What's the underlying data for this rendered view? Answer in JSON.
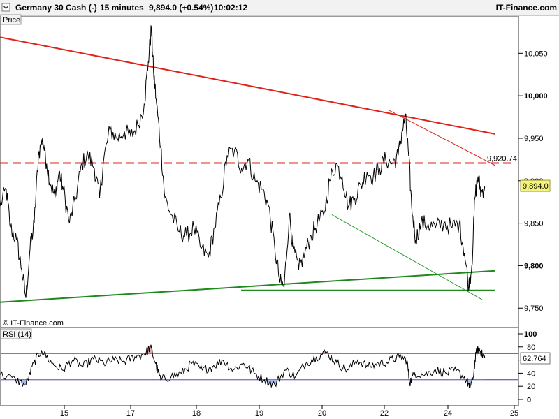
{
  "header": {
    "symbol": "Germany 30 Cash (-)",
    "interval": "15 minutes",
    "last": "9,894.0 (+0.54%)",
    "time": "10:02:12",
    "brand": "IT-Finance.com"
  },
  "copyright": "© IT-Finance.com",
  "chart_data": [
    {
      "type": "line",
      "title": "Price",
      "y_range": [
        9728,
        10093
      ],
      "y_ticks": [
        {
          "value": 9750,
          "label": "9,750"
        },
        {
          "value": 9800,
          "label": "9,800"
        },
        {
          "value": 9850,
          "label": "9,850"
        },
        {
          "value": 9900,
          "label": "9,900"
        },
        {
          "value": 9950,
          "label": "9,950"
        },
        {
          "value": 10000,
          "label": "10,000"
        },
        {
          "value": 10050,
          "label": "10,050"
        }
      ],
      "x_ticks": [
        "15",
        "17",
        "18",
        "19",
        "20",
        "22",
        "24",
        "25"
      ],
      "price_anchors": [
        [
          0,
          9870
        ],
        [
          0.012,
          9890
        ],
        [
          0.02,
          9845
        ],
        [
          0.032,
          9830
        ],
        [
          0.042,
          9795
        ],
        [
          0.05,
          9762
        ],
        [
          0.058,
          9820
        ],
        [
          0.066,
          9850
        ],
        [
          0.074,
          9930
        ],
        [
          0.082,
          9950
        ],
        [
          0.09,
          9920
        ],
        [
          0.098,
          9895
        ],
        [
          0.106,
          9880
        ],
        [
          0.114,
          9910
        ],
        [
          0.122,
          9890
        ],
        [
          0.134,
          9850
        ],
        [
          0.146,
          9880
        ],
        [
          0.158,
          9920
        ],
        [
          0.17,
          9930
        ],
        [
          0.182,
          9915
        ],
        [
          0.192,
          9880
        ],
        [
          0.2,
          9925
        ],
        [
          0.212,
          9960
        ],
        [
          0.226,
          9950
        ],
        [
          0.24,
          9958
        ],
        [
          0.252,
          9952
        ],
        [
          0.266,
          9965
        ],
        [
          0.278,
          9990
        ],
        [
          0.286,
          10040
        ],
        [
          0.292,
          10080
        ],
        [
          0.296,
          10030
        ],
        [
          0.302,
          9990
        ],
        [
          0.31,
          9940
        ],
        [
          0.318,
          9880
        ],
        [
          0.33,
          9860
        ],
        [
          0.346,
          9840
        ],
        [
          0.36,
          9835
        ],
        [
          0.374,
          9845
        ],
        [
          0.388,
          9820
        ],
        [
          0.402,
          9810
        ],
        [
          0.414,
          9845
        ],
        [
          0.426,
          9880
        ],
        [
          0.438,
          9930
        ],
        [
          0.452,
          9935
        ],
        [
          0.466,
          9915
        ],
        [
          0.478,
          9925
        ],
        [
          0.492,
          9900
        ],
        [
          0.506,
          9890
        ],
        [
          0.518,
          9870
        ],
        [
          0.53,
          9820
        ],
        [
          0.54,
          9780
        ],
        [
          0.548,
          9775
        ],
        [
          0.558,
          9860
        ],
        [
          0.566,
          9820
        ],
        [
          0.576,
          9795
        ],
        [
          0.588,
          9815
        ],
        [
          0.6,
          9835
        ],
        [
          0.612,
          9850
        ],
        [
          0.624,
          9860
        ],
        [
          0.636,
          9900
        ],
        [
          0.648,
          9920
        ],
        [
          0.66,
          9905
        ],
        [
          0.672,
          9870
        ],
        [
          0.684,
          9880
        ],
        [
          0.696,
          9895
        ],
        [
          0.708,
          9910
        ],
        [
          0.72,
          9905
        ],
        [
          0.732,
          9915
        ],
        [
          0.744,
          9925
        ],
        [
          0.756,
          9920
        ],
        [
          0.768,
          9930
        ],
        [
          0.776,
          9960
        ],
        [
          0.782,
          9975
        ],
        [
          0.788,
          9930
        ],
        [
          0.794,
          9870
        ],
        [
          0.802,
          9830
        ],
        [
          0.812,
          9850
        ],
        [
          0.826,
          9848
        ],
        [
          0.84,
          9845
        ],
        [
          0.856,
          9850
        ],
        [
          0.872,
          9845
        ],
        [
          0.886,
          9850
        ],
        [
          0.896,
          9815
        ],
        [
          0.904,
          9775
        ],
        [
          0.91,
          9800
        ],
        [
          0.916,
          9880
        ],
        [
          0.922,
          9905
        ],
        [
          0.928,
          9885
        ],
        [
          0.935,
          9894
        ]
      ],
      "lines": [
        {
          "name": "descending-resistance",
          "color": "#e0231a",
          "width": 2,
          "points": [
            [
              0,
              10069
            ],
            [
              0.955,
              9955
            ]
          ]
        },
        {
          "name": "short-resistance",
          "color": "#e0231a",
          "width": 1,
          "points": [
            [
              0.75,
              9983
            ],
            [
              0.955,
              9918
            ]
          ]
        },
        {
          "name": "horizontal-level",
          "color": "#e0231a",
          "width": 2,
          "dash": true,
          "label": "9,920.74",
          "points": [
            [
              0,
              9920.74
            ],
            [
              0.995,
              9920.74
            ]
          ]
        },
        {
          "name": "rising-support",
          "color": "#1e8a1e",
          "width": 2,
          "points": [
            [
              0,
              9757
            ],
            [
              0.955,
              9794
            ]
          ]
        },
        {
          "name": "horizontal-support",
          "color": "#1e8a1e",
          "width": 2,
          "points": [
            [
              0.465,
              9771
            ],
            [
              0.955,
              9771
            ]
          ]
        },
        {
          "name": "falling-support",
          "color": "#2e9a2e",
          "width": 1,
          "points": [
            [
              0.64,
              9860
            ],
            [
              0.93,
              9760
            ]
          ]
        }
      ],
      "last_value_label": "9,894.0"
    },
    {
      "type": "line",
      "title": "RSI (14)",
      "y_range": [
        0,
        100
      ],
      "y_ticks": [
        {
          "value": 0,
          "label": "0"
        },
        {
          "value": 20,
          "label": "20"
        },
        {
          "value": 40,
          "label": "40"
        },
        {
          "value": 60,
          "label": "60"
        },
        {
          "value": 80,
          "label": "80"
        },
        {
          "value": 100,
          "label": "100"
        }
      ],
      "levels": [
        70,
        30
      ],
      "rsi_anchors": [
        [
          0,
          38
        ],
        [
          0.03,
          30
        ],
        [
          0.05,
          22
        ],
        [
          0.065,
          55
        ],
        [
          0.08,
          75
        ],
        [
          0.1,
          55
        ],
        [
          0.12,
          45
        ],
        [
          0.14,
          60
        ],
        [
          0.16,
          50
        ],
        [
          0.18,
          62
        ],
        [
          0.2,
          55
        ],
        [
          0.22,
          60
        ],
        [
          0.24,
          58
        ],
        [
          0.26,
          65
        ],
        [
          0.28,
          70
        ],
        [
          0.29,
          80
        ],
        [
          0.3,
          55
        ],
        [
          0.31,
          30
        ],
        [
          0.33,
          35
        ],
        [
          0.35,
          40
        ],
        [
          0.37,
          55
        ],
        [
          0.39,
          45
        ],
        [
          0.41,
          50
        ],
        [
          0.43,
          60
        ],
        [
          0.45,
          45
        ],
        [
          0.47,
          55
        ],
        [
          0.49,
          40
        ],
        [
          0.51,
          30
        ],
        [
          0.53,
          22
        ],
        [
          0.55,
          45
        ],
        [
          0.57,
          35
        ],
        [
          0.59,
          55
        ],
        [
          0.61,
          65
        ],
        [
          0.63,
          72
        ],
        [
          0.65,
          55
        ],
        [
          0.67,
          45
        ],
        [
          0.69,
          60
        ],
        [
          0.71,
          50
        ],
        [
          0.73,
          55
        ],
        [
          0.75,
          58
        ],
        [
          0.77,
          65
        ],
        [
          0.785,
          60
        ],
        [
          0.79,
          25
        ],
        [
          0.8,
          40
        ],
        [
          0.82,
          38
        ],
        [
          0.84,
          45
        ],
        [
          0.86,
          40
        ],
        [
          0.88,
          44
        ],
        [
          0.9,
          30
        ],
        [
          0.905,
          18
        ],
        [
          0.912,
          30
        ],
        [
          0.918,
          70
        ],
        [
          0.924,
          78
        ],
        [
          0.93,
          68
        ],
        [
          0.935,
          62.764
        ]
      ],
      "last_value_label": "62.764"
    }
  ]
}
